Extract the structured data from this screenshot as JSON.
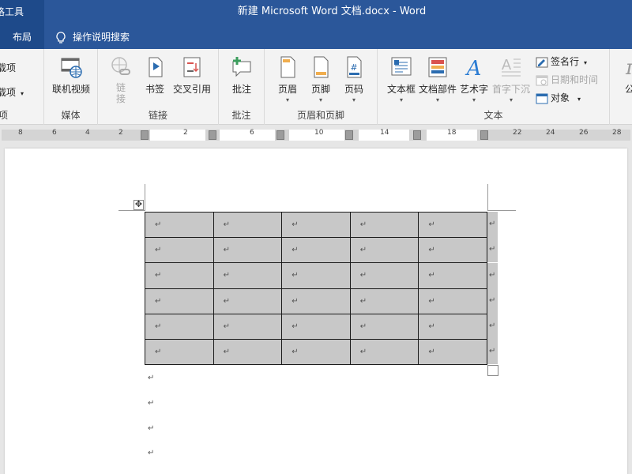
{
  "window": {
    "context_tab": "格工具",
    "title": "新建 Microsoft Word 文档.docx  -  Word"
  },
  "tabs": {
    "layout": "布局",
    "tell_me": "操作说明搜索"
  },
  "ribbon": {
    "addins": {
      "item1": "载项",
      "item2": "载项",
      "label": "项"
    },
    "media": {
      "online_video": "联机视频",
      "label": "媒体"
    },
    "links": {
      "link": "链接",
      "bookmark": "书签",
      "cross_ref": "交叉引用",
      "label": "链接"
    },
    "comments": {
      "comment": "批注",
      "label": "批注"
    },
    "header_footer": {
      "header": "页眉",
      "footer": "页脚",
      "page_number": "页码",
      "label": "页眉和页脚"
    },
    "text": {
      "textbox": "文本框",
      "quick_parts": "文档部件",
      "wordart": "艺术字",
      "dropcap": "首字下沉",
      "signature": "签名行",
      "datetime": "日期和时间",
      "object": "对象",
      "label": "文本"
    },
    "symbols": {
      "equation": "公"
    }
  },
  "ruler": {
    "numbers": [
      "8",
      "6",
      "4",
      "2",
      "2",
      "6",
      "10",
      "14",
      "18",
      "22",
      "24",
      "26",
      "28"
    ]
  },
  "document": {
    "table": {
      "rows": 6,
      "cols": 5,
      "cell_mark": "↵"
    },
    "para_mark": "↵"
  }
}
